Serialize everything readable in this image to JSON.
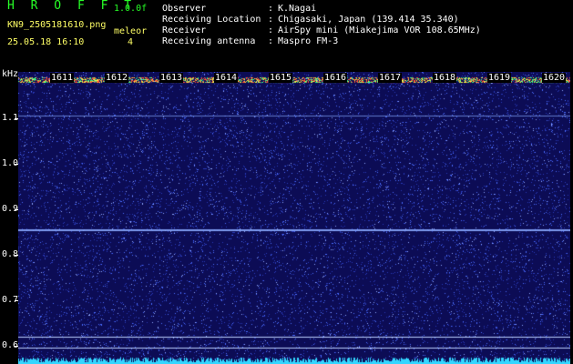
{
  "app": {
    "title": "H R O F F T",
    "version": "1.0.0f",
    "file_name": "KN9_2505181610.png",
    "timestamp": "25.05.18 16:10",
    "meteor_label": "meleor",
    "meteor_count": "4"
  },
  "meta": [
    {
      "key": "Observer",
      "value": "K.Nagai"
    },
    {
      "key": "Receiving Location",
      "value": "Chigasaki, Japan (139.414 35.340)"
    },
    {
      "key": "Receiver",
      "value": "AirSpy mini (Miakejima VOR 108.65MHz)"
    },
    {
      "key": "Receiving antenna",
      "value": "Maspro FM-3"
    }
  ],
  "spectrogram": {
    "y_unit": "kHz",
    "y_ticks": [
      "1.1",
      "1.0",
      "0.9",
      "0.8",
      "0.7",
      "0.6"
    ],
    "x_ticks": [
      "1611",
      "1612",
      "1613",
      "1614",
      "1615",
      "1616",
      "1617",
      "1618",
      "1619",
      "1620"
    ],
    "colors": {
      "background": "#0c0c55",
      "noise": "#4b6cff",
      "signal_line": "#88a8ff",
      "baseline": "#33d6ff"
    }
  }
}
